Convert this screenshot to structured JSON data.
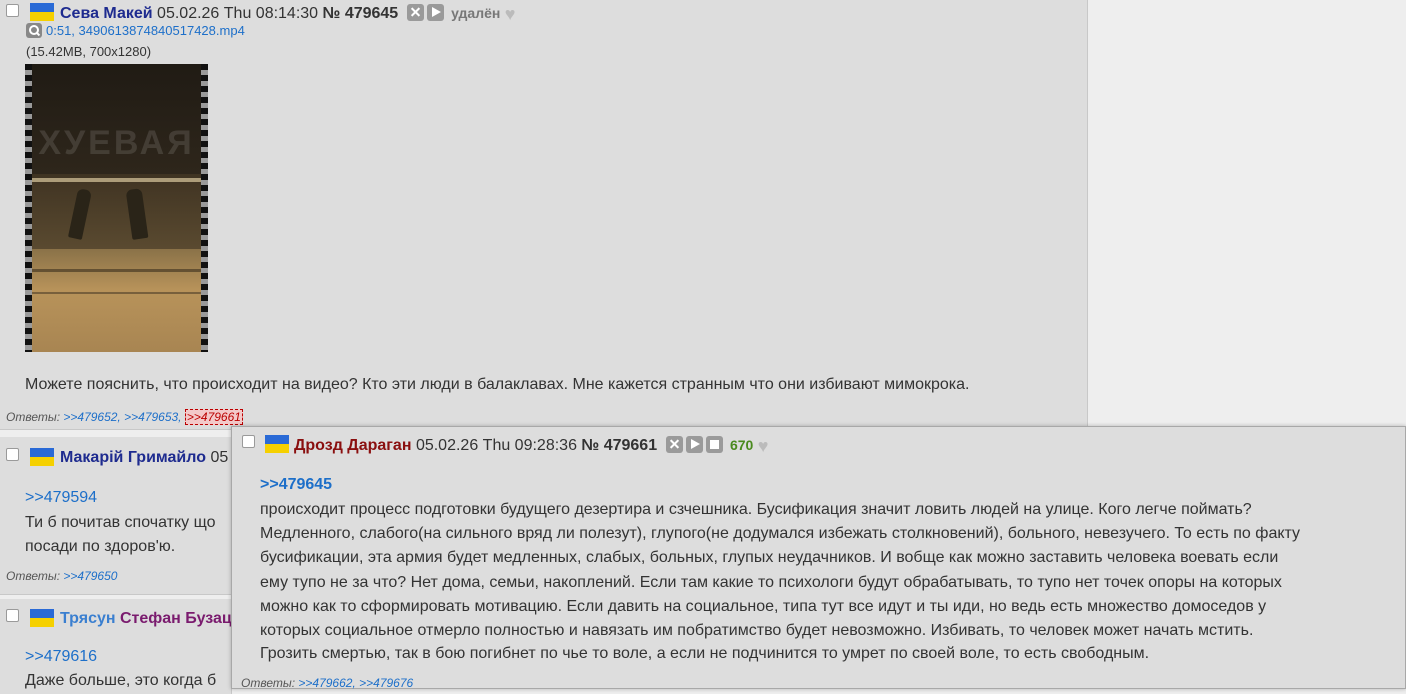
{
  "post1": {
    "name": "Сева Макей",
    "datetime": "05.02.26 Thu 08:14:30",
    "number": "№ 479645",
    "status": "удалён",
    "file_link": "0:51, 3490613874840517428.mp4",
    "file_meta": "(15.42MB, 700x1280)",
    "watermark": "ХУЕВАЯ",
    "text": "Можете пояснить, что происходит на видео? Кто эти люди в балаклавах. Мне кажется странным что они избивают мимокрока.",
    "answers_label": "Ответы:",
    "answers": [
      ">>479652,",
      ">>479653,",
      ">>479661"
    ]
  },
  "post2": {
    "name": "Макарій Гримайло",
    "datetime_partial": "05",
    "reply": ">>479594",
    "lines": [
      "Ти б почитав спочатку що",
      "посади по здоров'ю."
    ],
    "answers_label": "Ответы:",
    "answers": [
      ">>479650"
    ]
  },
  "post3": {
    "name_first": "Трясун",
    "name_second": "Стефан Бузац",
    "reply": ">>479616",
    "line": "Даже больше, это когда б"
  },
  "popup": {
    "name": "Дрозд Дараган",
    "datetime": "05.02.26 Thu 09:28:36",
    "number": "№ 479661",
    "score": "670",
    "reply": ">>479645",
    "lines": [
      "происходит процесс подготовки будущего дезертира и сзчешника. Бусификация значит ловить людей на улице. Кого легче поймать?",
      "Медленного, слабого(на сильного вряд ли полезут), глупого(не додумался избежать столкновений), больного, невезучего. То есть по факту",
      "бусификации, эта армия будет медленных, слабых, больных, глупых неудачников. И вобще как можно заставить человека воевать если",
      "ему тупо не за что? Нет дома, семьи, накоплений. Если там какие то психологи будут обрабатывать, то тупо нет точек опоры на которых",
      "можно как то сформировать мотивацию. Если давить на социальное, типа тут все идут и ты иди, но ведь есть множество домоседов у",
      "которых социальное отмерло полностью и навязать им побратимство будет невозможно. Избивать, то человек может начать мстить.",
      "Грозить смертью, так в бою погибнет по чье то воле, а если не подчинится то умрет по своей воле, то есть свободным."
    ],
    "answers_label": "Ответы:",
    "answers": [
      ">>479662,",
      ">>479676"
    ]
  },
  "colors": {
    "post_bg": "#dddddd",
    "page_bg": "#eeeeee",
    "link": "#1d6fc9",
    "name": "#1e2b8f",
    "name_red": "#8a0f0f",
    "score": "#4a8a1e"
  },
  "icons": [
    "search-icon",
    "hide-icon",
    "play-icon",
    "stop-icon",
    "like-heart-icon",
    "ukraine-flag-icon"
  ]
}
